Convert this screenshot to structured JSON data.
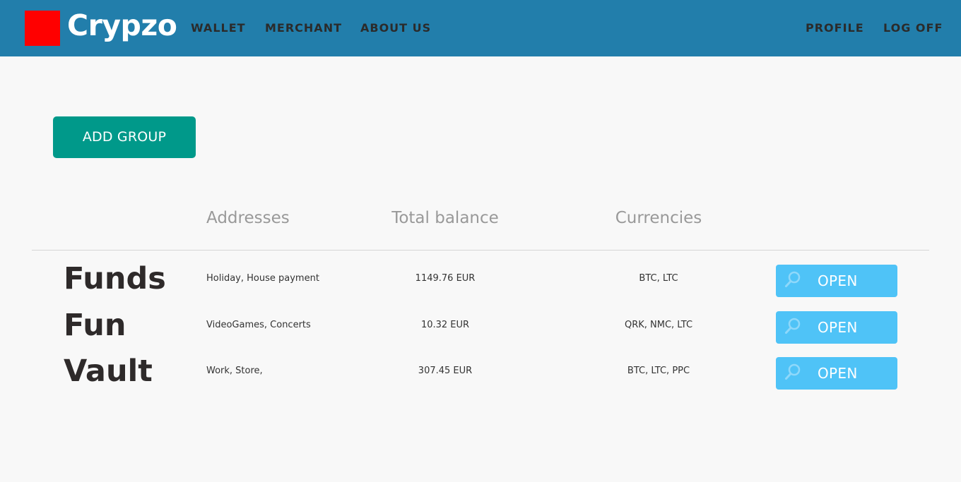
{
  "header": {
    "brand": "Crypzo",
    "logo_color": "#ff0000",
    "background_color": "#227eab",
    "nav_left": [
      {
        "label": "WALLET"
      },
      {
        "label": "MERCHANT"
      },
      {
        "label": "ABOUT US"
      }
    ],
    "nav_right": [
      {
        "label": "PROFILE"
      },
      {
        "label": "LOG OFF"
      }
    ]
  },
  "main": {
    "add_group_label": "ADD GROUP",
    "add_group_color": "#00998a",
    "columns": {
      "addresses": "Addresses",
      "balance": "Total balance",
      "currencies": "Currencies"
    },
    "groups": [
      {
        "name": "Funds",
        "addresses": "Holiday, House payment",
        "balance": "1149.76 EUR",
        "currencies": "BTC, LTC",
        "action_label": "OPEN",
        "action_icon": "search-icon"
      },
      {
        "name": "Fun",
        "addresses": "VideoGames, Concerts",
        "balance": "10.32 EUR",
        "currencies": "QRK, NMC, LTC",
        "action_label": "OPEN",
        "action_icon": "search-icon"
      },
      {
        "name": "Vault",
        "addresses": "Work, Store,",
        "balance": "307.45 EUR",
        "currencies": "BTC, LTC, PPC",
        "action_label": "OPEN",
        "action_icon": "search-icon"
      }
    ],
    "open_button_color": "#4fc3f7"
  }
}
